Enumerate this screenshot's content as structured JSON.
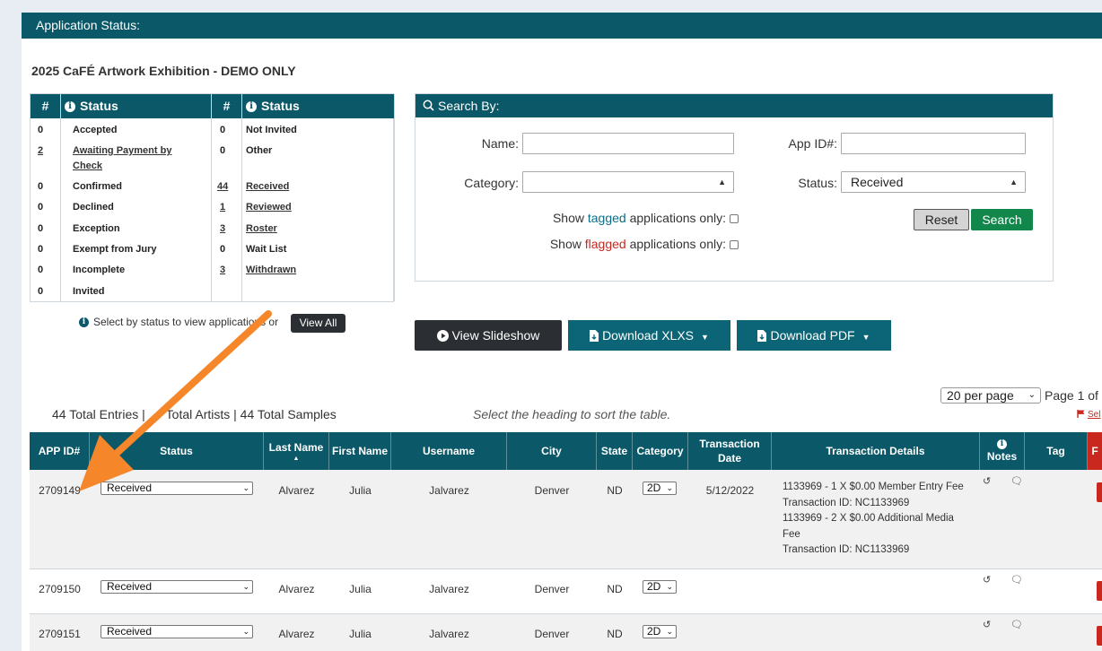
{
  "header": {
    "title": "Application Status:"
  },
  "exhibition": {
    "title": "2025 CaFÉ Artwork Exhibition - DEMO ONLY"
  },
  "status_table": {
    "col_hash": "#",
    "col_status": "Status",
    "left": [
      {
        "count": "0",
        "label": "Accepted",
        "link": false
      },
      {
        "count": "2",
        "label": "Awaiting Payment by",
        "label2": "Check",
        "link": true
      },
      {
        "count": "0",
        "label": "Confirmed",
        "link": false
      },
      {
        "count": "0",
        "label": "Declined",
        "link": false
      },
      {
        "count": "0",
        "label": "Exception",
        "link": false
      },
      {
        "count": "0",
        "label": "Exempt from Jury",
        "link": false
      },
      {
        "count": "0",
        "label": "Incomplete",
        "link": false
      },
      {
        "count": "0",
        "label": "Invited",
        "link": false
      }
    ],
    "right": [
      {
        "count": "0",
        "label": "Not Invited",
        "link": false
      },
      {
        "count": "0",
        "label": "Other",
        "link": false
      },
      {
        "count": "44",
        "label": "Received",
        "link": true
      },
      {
        "count": "1",
        "label": "Reviewed",
        "link": true
      },
      {
        "count": "3",
        "label": "Roster",
        "link": true
      },
      {
        "count": "0",
        "label": "Wait List",
        "link": false
      },
      {
        "count": "3",
        "label": "Withdrawn",
        "link": true
      }
    ],
    "note": "Select by status to view applications or",
    "view_all": "View All"
  },
  "search": {
    "heading": "Search By:",
    "name_label": "Name:",
    "name_value": "",
    "appid_label": "App ID#:",
    "appid_value": "",
    "category_label": "Category:",
    "category_value": "",
    "status_label": "Status:",
    "status_value": "Received",
    "tagged_pre": "Show ",
    "tagged_word": "tagged",
    "tagged_post": " applications only:",
    "flagged_pre": "Show ",
    "flagged_word": "flagged",
    "flagged_post": " applications only:",
    "reset": "Reset",
    "search": "Search"
  },
  "actions": {
    "slideshow": "View Slideshow",
    "xlsx": "Download XLXS",
    "pdf": "Download PDF"
  },
  "pagination": {
    "per_page": "20 per page",
    "page_of": "Page 1 of",
    "select_flag": "Sel"
  },
  "summary": {
    "totals_a": "44 Total Entries | ",
    "totals_b": "Total Artists | 44 Total Samples",
    "sort_hint": "Select the heading to sort the table."
  },
  "table": {
    "headers": {
      "app_id": "APP ID#",
      "status": "Status",
      "last_name": "Last Name",
      "first_name": "First Name",
      "username": "Username",
      "city": "City",
      "state": "State",
      "category": "Category",
      "txn_date": "Transaction Date",
      "txn_details": "Transaction Details",
      "notes": "Notes",
      "tag": "Tag",
      "flag": "F"
    },
    "rows": [
      {
        "app_id": "2709149",
        "status": "Received",
        "last_name": "Alvarez",
        "first_name": "Julia",
        "username": "Jalvarez",
        "city": "Denver",
        "state": "ND",
        "category": "2D",
        "txn_date": "5/12/2022",
        "txn_lines": [
          "1133969 - 1 X $0.00 Member Entry Fee",
          "Transaction ID: NC1133969",
          "1133969 - 2 X $0.00 Additional Media",
          "Fee",
          "Transaction ID: NC1133969"
        ]
      },
      {
        "app_id": "2709150",
        "status": "Received",
        "last_name": "Alvarez",
        "first_name": "Julia",
        "username": "Jalvarez",
        "city": "Denver",
        "state": "ND",
        "category": "2D",
        "txn_date": "",
        "txn_lines": []
      },
      {
        "app_id": "2709151",
        "status": "Received",
        "last_name": "Alvarez",
        "first_name": "Julia",
        "username": "Jalvarez",
        "city": "Denver",
        "state": "ND",
        "category": "2D",
        "txn_date": "",
        "txn_lines": []
      }
    ]
  },
  "icons": {
    "info": "info-icon",
    "search": "search-icon",
    "play": "play-icon",
    "file": "file-download-icon",
    "history": "history-icon",
    "comment": "comment-icon",
    "flag": "flag-icon"
  },
  "colors": {
    "brand": "#0a5868",
    "button_teal": "#0b6576",
    "search_green": "#12874b",
    "flag_red": "#c8281e",
    "annotation_arrow": "#f5872a"
  }
}
